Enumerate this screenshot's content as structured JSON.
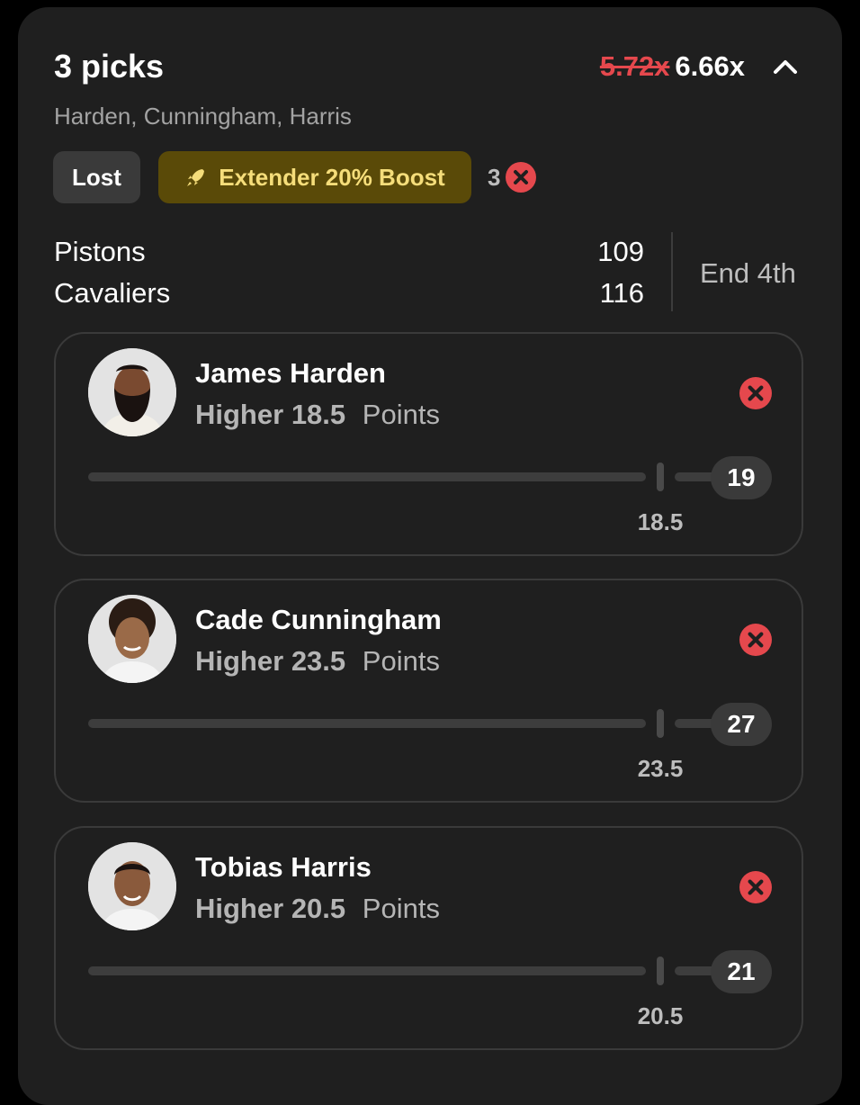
{
  "header": {
    "title": "3 picks",
    "old_multiplier": "5.72x",
    "new_multiplier": "6.66x",
    "players_summary": "Harden, Cunningham, Harris"
  },
  "badges": {
    "status": "Lost",
    "boost": "Extender 20% Boost",
    "lost_count": "3"
  },
  "game": {
    "teams": [
      {
        "name": "Pistons",
        "score": "109"
      },
      {
        "name": "Cavaliers",
        "score": "116"
      }
    ],
    "period": "End 4th"
  },
  "picks": [
    {
      "player": "James Harden",
      "direction": "Higher",
      "line": "18.5",
      "stat": "Points",
      "actual": "19",
      "line_label": "18.5"
    },
    {
      "player": "Cade Cunningham",
      "direction": "Higher",
      "line": "23.5",
      "stat": "Points",
      "actual": "27",
      "line_label": "23.5"
    },
    {
      "player": "Tobias Harris",
      "direction": "Higher",
      "line": "20.5",
      "stat": "Points",
      "actual": "21",
      "line_label": "20.5"
    }
  ],
  "colors": {
    "background": "#000000",
    "card": "#1f1f1f",
    "loss_red": "#e5484d",
    "boost_bg": "#5a4a08",
    "boost_text": "#f5dd7a"
  },
  "icons": {
    "collapse": "chevron-up-icon",
    "boost": "rocket-icon",
    "loss": "x-circle-icon",
    "avatar": "player-avatar"
  }
}
